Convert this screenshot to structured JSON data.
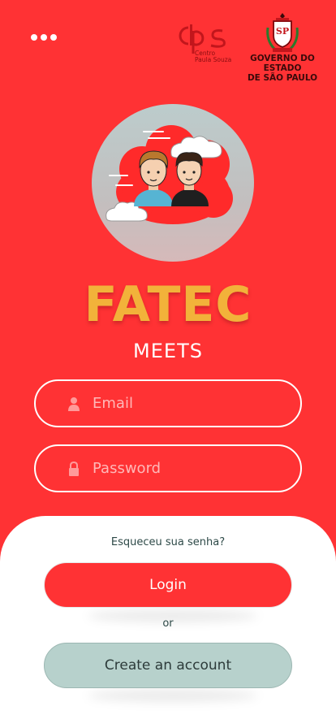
{
  "header": {
    "menu_icon": "more-horizontal-icon",
    "cps_logo": {
      "brand": "cps",
      "line1": "Centro",
      "line2": "Paula Souza"
    },
    "sp_logo": {
      "seal_letters": "SP",
      "line1": "GOVERNO DO ESTADO",
      "line2": "DE SÃO PAULO"
    }
  },
  "hero": {
    "avatar_icon": "two-users-cloud-illustration"
  },
  "brand": {
    "title": "FATEC",
    "subtitle": "MEETS"
  },
  "form": {
    "email": {
      "placeholder": "Email",
      "value": "",
      "icon": "user-icon"
    },
    "password": {
      "placeholder": "Password",
      "value": "",
      "icon": "lock-icon"
    }
  },
  "actions": {
    "forgot": "Esqueceu sua senha?",
    "login": "Login",
    "or": "or",
    "create": "Create an account"
  },
  "colors": {
    "background": "#ff3234",
    "brand": "#f2b23a",
    "secondary_button": "#b7d1cc"
  }
}
